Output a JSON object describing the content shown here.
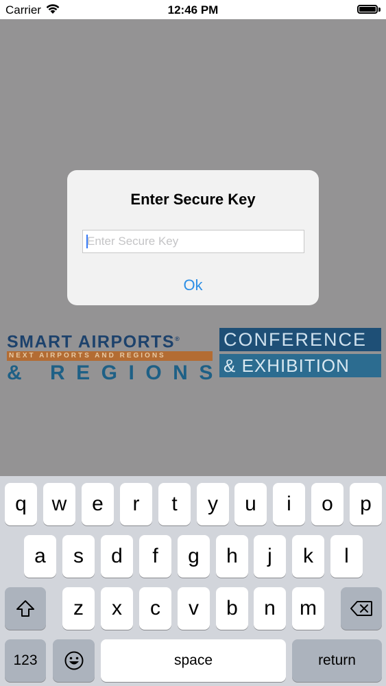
{
  "status_bar": {
    "carrier": "Carrier",
    "time": "12:46 PM"
  },
  "logo": {
    "line1": "SMART AIRPORTS",
    "registered": "®",
    "tagline": "NEXT AIRPORTS AND REGIONS",
    "line2": "& REGIONS",
    "right_line1": "CONFERENCE",
    "right_line2": "& EXHIBITION"
  },
  "alert": {
    "title": "Enter Secure Key",
    "input_placeholder": "Enter Secure Key",
    "input_value": "",
    "ok_label": "Ok"
  },
  "keyboard": {
    "row1": [
      "q",
      "w",
      "e",
      "r",
      "t",
      "y",
      "u",
      "i",
      "o",
      "p"
    ],
    "row2": [
      "a",
      "s",
      "d",
      "f",
      "g",
      "h",
      "j",
      "k",
      "l"
    ],
    "row3": [
      "z",
      "x",
      "c",
      "v",
      "b",
      "n",
      "m"
    ],
    "numbers_label": "123",
    "space_label": "space",
    "return_label": "return",
    "shift_icon": "shift-arrow-icon",
    "delete_icon": "backspace-icon",
    "emoji_icon": "emoji-face-icon"
  },
  "colors": {
    "dim_overlay": "#949394",
    "alert_bg": "#f2f2f2",
    "ok_blue": "#2c8ee5",
    "keyboard_bg": "#d2d5db"
  }
}
